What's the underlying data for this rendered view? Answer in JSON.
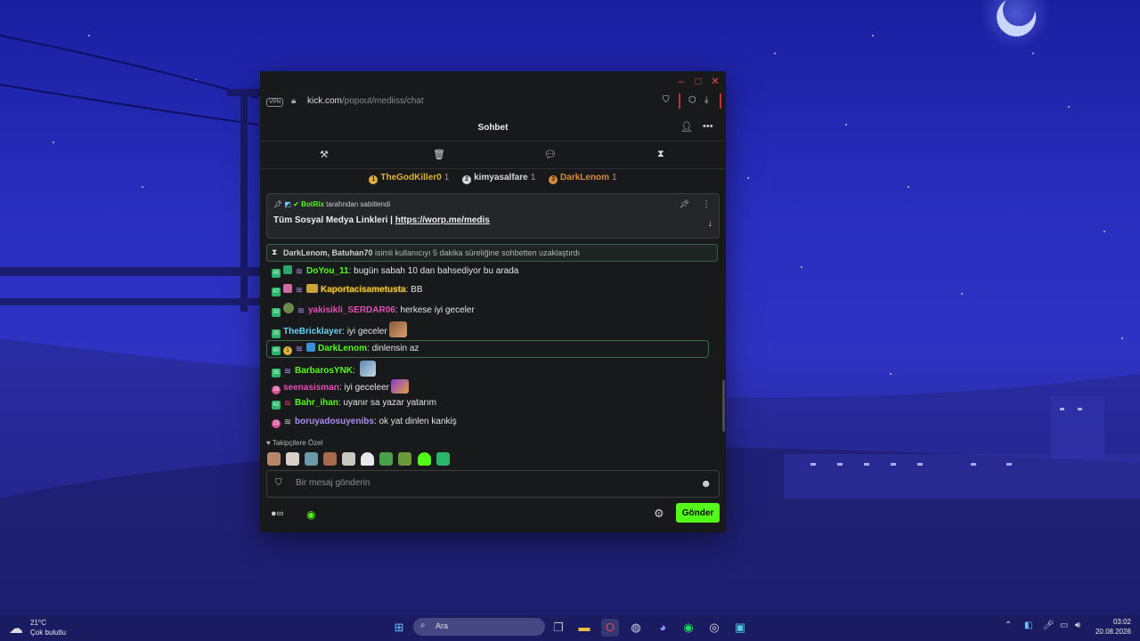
{
  "window": {
    "vpn_label": "VPN",
    "url_host": "kick.com",
    "url_path": "/popout/mediiss/chat",
    "title": "Sohbet"
  },
  "leaderboard": [
    {
      "name": "TheGodKiller0",
      "count": "1",
      "color": "#e0b13a"
    },
    {
      "name": "kimyasalfare",
      "count": "1",
      "color": "#d8d8d8"
    },
    {
      "name": "DarkLenom",
      "count": "1",
      "color": "#d98a3a"
    }
  ],
  "pinned": {
    "bot_name": "BotRix",
    "pinned_by_text": "tarafından sabitlendi",
    "text": "Tüm Sosyal Medya Linkleri | ",
    "link": "https://worp.me/medis"
  },
  "timeout": {
    "users": "DarkLenom, Batuhan70",
    "text": " isimli kullanıcıyı 5 dakika süreliğine sohbetten uzaklaştırdı"
  },
  "messages": [
    {
      "user": "DoYou_11",
      "text": ": bugün sabah 10 dan bahsediyor bu arada",
      "color": "#53fc18",
      "badge": "45"
    },
    {
      "user": "Kaportacisametusta",
      "text": ": BB",
      "color": "#e2c83a",
      "badge": "47"
    },
    {
      "user": "yakisikli_SERDAR06",
      "text": ": herkese iyi geceler",
      "color": "#e24fb6",
      "badge": "33"
    },
    {
      "user": "TheBricklayer",
      "text": ": iyi geceler",
      "color": "#6ad0f5",
      "badge": "35"
    },
    {
      "user": "DarkLenom",
      "text": ": dinlensin az",
      "color": "#53fc18",
      "badge": "40"
    },
    {
      "user": "BarbarosYNK",
      "text": ": ",
      "color": "#53fc18",
      "badge": "35"
    },
    {
      "user": "seenasisman",
      "text": ": iyi geceleer",
      "color": "#e24fb6",
      "badge": "28"
    },
    {
      "user": "Bahr_ihan",
      "text": ": uyanır sa yazar yatarım",
      "color": "#53fc18",
      "badge": "42"
    },
    {
      "user": "boruyadosuyenibs",
      "text": ": ok yat dinlen kankiş",
      "color": "#a98ef0",
      "badge": "23"
    }
  ],
  "followers_label": "Takipçilere Özel",
  "input": {
    "placeholder": "Bir mesaj gönderin"
  },
  "send_label": "Gönder",
  "taskbar": {
    "temperature": "21°C",
    "weather": "Çok bulutlu",
    "search_label": "Ara",
    "time": "03:02",
    "date": "20.08.2026"
  }
}
